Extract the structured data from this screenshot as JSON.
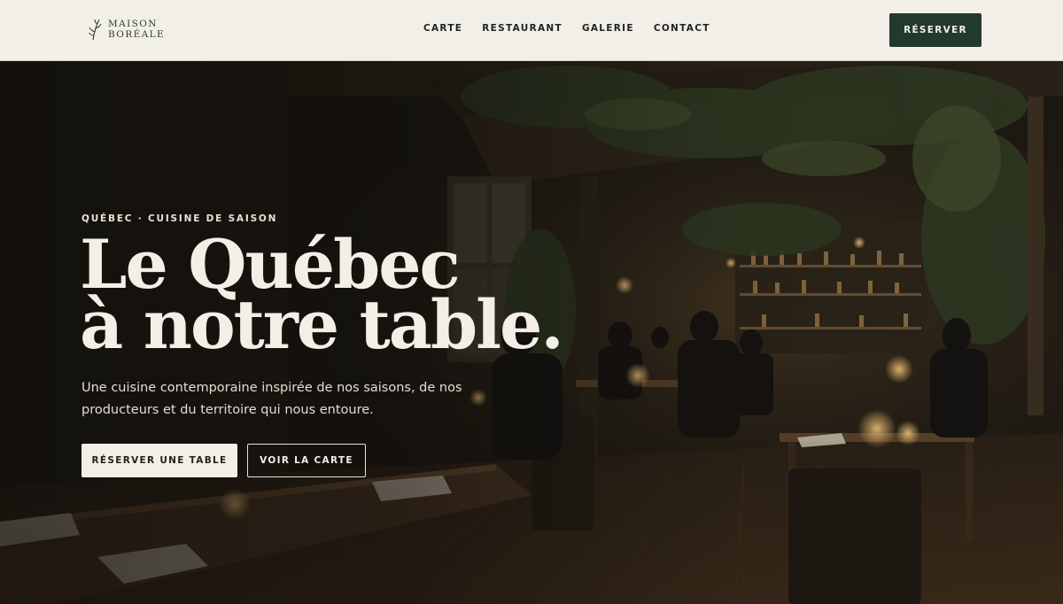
{
  "header": {
    "logo_line1": "MAISON",
    "logo_line2": "BORÉALE",
    "nav": [
      "CARTE",
      "RESTAURANT",
      "GALERIE",
      "CONTACT"
    ],
    "reserve_label": "RÉSERVER"
  },
  "hero": {
    "eyebrow": "QUÉBEC · CUISINE DE SAISON",
    "headline_line1": "Le Québec",
    "headline_line2": "à notre table.",
    "subtitle": "Une cuisine contemporaine inspirée de nos saisons, de nos producteurs et du territoire qui nous entoure.",
    "cta_primary": "RÉSERVER UNE TABLE",
    "cta_secondary": "VOIR LA CARTE"
  },
  "colors": {
    "header_bg": "#f2efe8",
    "brand_green": "#23392d",
    "hero_text": "#f4efe6"
  },
  "icons": {
    "logo": "sprig-icon"
  }
}
